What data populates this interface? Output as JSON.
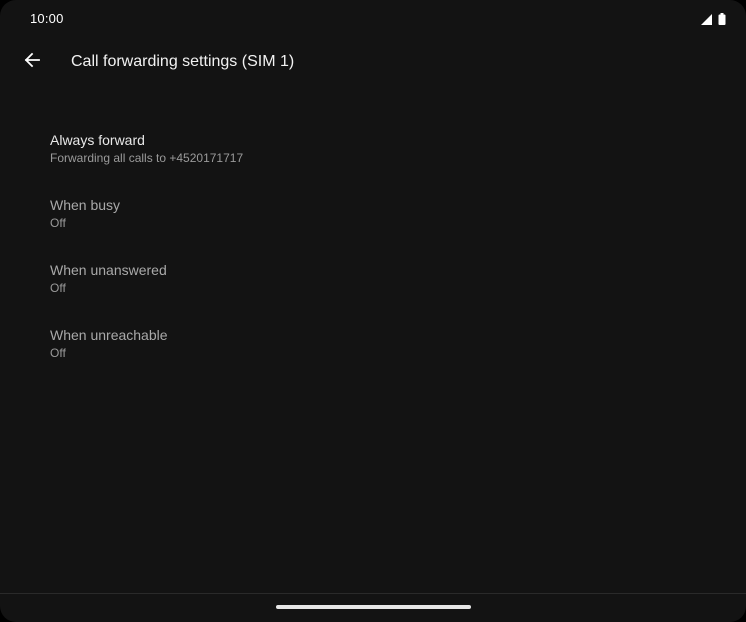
{
  "status_bar": {
    "time": "10:00",
    "icons": [
      "cellular-signal-icon",
      "battery-icon"
    ]
  },
  "app_bar": {
    "back_icon": "arrow-left-icon",
    "title": "Call forwarding settings (SIM 1)"
  },
  "settings": [
    {
      "title": "Always forward",
      "summary": "Forwarding all calls to +4520171717",
      "enabled": true
    },
    {
      "title": "When busy",
      "summary": "Off",
      "enabled": false
    },
    {
      "title": "When unanswered",
      "summary": "Off",
      "enabled": false
    },
    {
      "title": "When unreachable",
      "summary": "Off",
      "enabled": false
    }
  ],
  "colors": {
    "background": "#131313",
    "primary_text": "#e8e8e8",
    "secondary_text": "#9a9a9a"
  }
}
